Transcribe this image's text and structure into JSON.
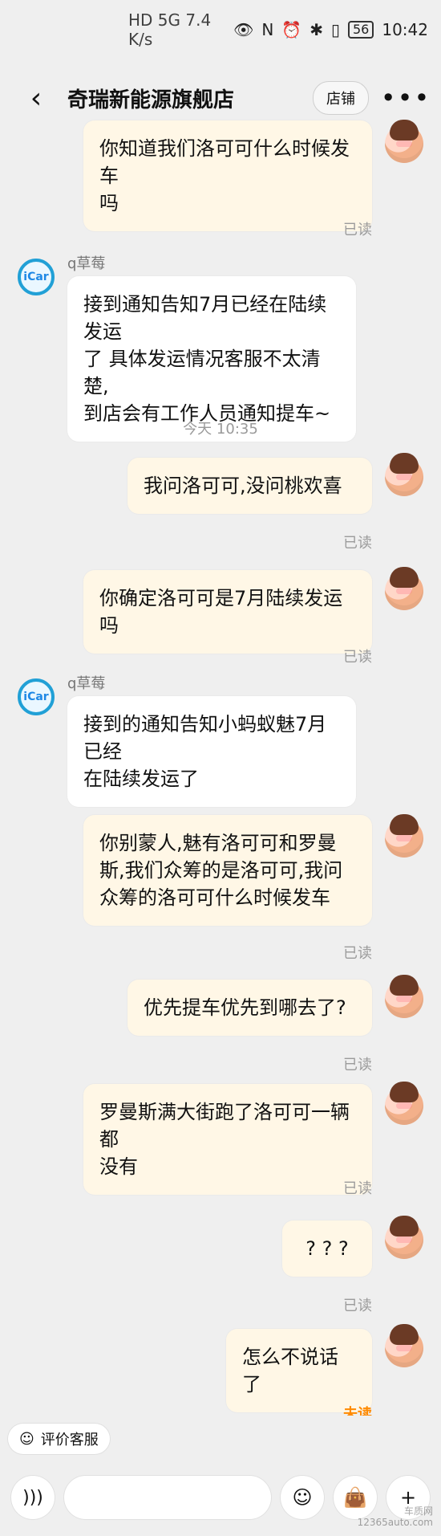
{
  "status": {
    "left_text": "HD 5G 7.4 K/s",
    "time": "10:42",
    "battery": "56"
  },
  "header": {
    "title": "奇瑞新能源旗舰店",
    "store_button": "店铺",
    "more": "•••"
  },
  "messages": [
    {
      "side": "me",
      "text": "你知道我们洛可可什么时候发车\n吗",
      "status": "已读"
    },
    {
      "side": "shop",
      "sender": "q草莓",
      "text": "接到通知告知7月已经在陆续发运\n了 具体发运情况客服不太清楚,\n到店会有工作人员通知提车~"
    },
    {
      "type": "time",
      "text": "今天 10:35"
    },
    {
      "side": "me",
      "text": "我问洛可可,没问桃欢喜",
      "status": "已读"
    },
    {
      "side": "me",
      "text": "你确定洛可可是7月陆续发运吗",
      "status": "已读"
    },
    {
      "side": "shop",
      "sender": "q草莓",
      "text": "接到的通知告知小蚂蚁魅7月已经\n在陆续发运了"
    },
    {
      "side": "me",
      "text": "你别蒙人,魅有洛可可和罗曼\n斯,我们众筹的是洛可可,我问\n众筹的洛可可什么时候发车",
      "status": "已读"
    },
    {
      "side": "me",
      "text": "优先提车优先到哪去了?",
      "status": "已读"
    },
    {
      "side": "me",
      "text": "罗曼斯满大街跑了洛可可一辆都\n没有",
      "status": "已读"
    },
    {
      "side": "me",
      "text": "? ? ?",
      "status": "已读"
    },
    {
      "side": "me",
      "text": "怎么不说话了",
      "status": "未读"
    }
  ],
  "bottom": {
    "rate_label": "评价客服",
    "input_placeholder": "",
    "watermark_line1": "车质网",
    "watermark_line2": "12365auto.com"
  }
}
